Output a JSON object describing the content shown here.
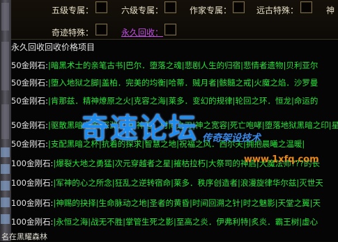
{
  "options": [
    {
      "label": "五级专属："
    },
    {
      "label": "六级专属："
    },
    {
      "label": "作家专属："
    },
    {
      "label": "远古特殊："
    },
    {
      "label": "神"
    },
    {
      "label": "奇迹特殊："
    },
    {
      "label": "永久回收："
    }
  ],
  "list_title": "永久回收回收价格项目",
  "rows": [
    {
      "price": "50金刚石:",
      "items": "|暗黑术士的亲笔古书|巴尔．堕落之魂|悲剧人生的归宿|悲情者遗物|贝利亚尔"
    },
    {
      "price": "50金刚石:",
      "items": "|堕入地狱之脚|盖柏．完美的均衡|哈蒂．贼月者|骸髓之戒|火魔之焰．沙罗曼"
    },
    {
      "price": "50金刚石:",
      "items": "|肯那兹．精神燎原之火|克容之海|莱多．变幻的规律|轮回之环．恒龙|命运的"
    },
    {
      "price": "50金刚石:",
      "items": "|驱散黑暗之矛|深渊之魂|神者．时间之刃|神之宽容|死亡咆哮|堕落地狱黑暗之印|星之海"
    },
    {
      "price": "50金刚石:",
      "items": "|支配黑暗之杯|抗着的探求|智慧之地|祝福之风．西尔夫|拥抱晨曦之温暖|"
    },
    {
      "price": "100金刚石:",
      "items": "|爆裂大地之勇猛|次元穿越者之星|摧枯拉朽|大祭司的神启|大魔法师???的长"
    },
    {
      "price": "100金刚石:",
      "items": "|军神的心之所念|狂乱之逆转宿命|莱多．秩序创造者|浪漫旋律华尔兹|灭世天"
    },
    {
      "price": "100金刚石:",
      "items": "|神赐的抉择|生命脉动之地|圣者的黄昏|时间回溯之针|时之魅影|天堂之翼|天"
    },
    {
      "price": "100金刚石:",
      "items": "|永恒之海|战无不胜|掌管生死之影|至高之炎．伊弗利特|炙炎．霸王树|虚心"
    }
  ],
  "watermark": {
    "main": "奇速论坛",
    "sub": "传奇架设技术",
    "site": "www.1xfq.com"
  },
  "bottom_text": "名在黑耀森林"
}
